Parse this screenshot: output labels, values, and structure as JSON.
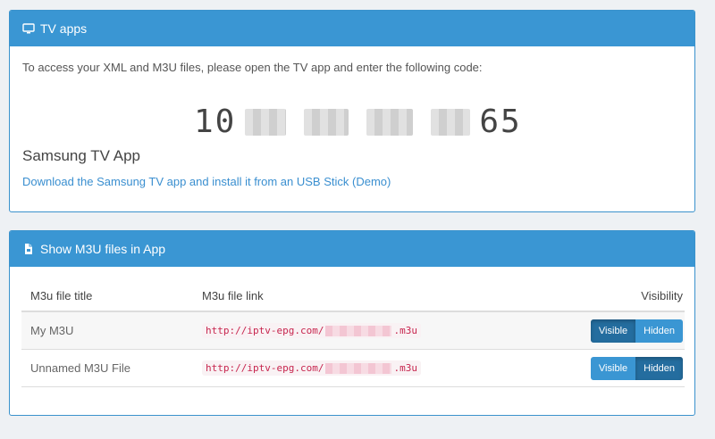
{
  "tv_apps": {
    "title": "TV apps",
    "intro": "To access your XML and M3U files, please open the TV app and enter the following code:",
    "code_prefix": "10",
    "code_suffix": "65",
    "samsung_title": "Samsung TV App",
    "samsung_link": "Download the Samsung TV app and install it from an USB Stick (Demo)"
  },
  "m3u_panel": {
    "title": "Show M3U files in App",
    "columns": [
      "M3u file title",
      "M3u file link",
      "Visibility"
    ],
    "rows": [
      {
        "title": "My M3U",
        "link_prefix": "http://iptv-epg.com/",
        "link_suffix": ".m3u",
        "visible_label": "Visible",
        "hidden_label": "Hidden",
        "state": "visible"
      },
      {
        "title": "Unnamed M3U File",
        "link_prefix": "http://iptv-epg.com/",
        "link_suffix": ".m3u",
        "visible_label": "Visible",
        "hidden_label": "Hidden",
        "state": "hidden"
      }
    ]
  },
  "colors": {
    "accent": "#3a96d3",
    "active": "#246d9f",
    "link": "#3a8fd0",
    "code_text": "#c7254e"
  },
  "icons": {
    "tv_apps": "monitor-icon",
    "m3u_panel": "file-icon"
  }
}
